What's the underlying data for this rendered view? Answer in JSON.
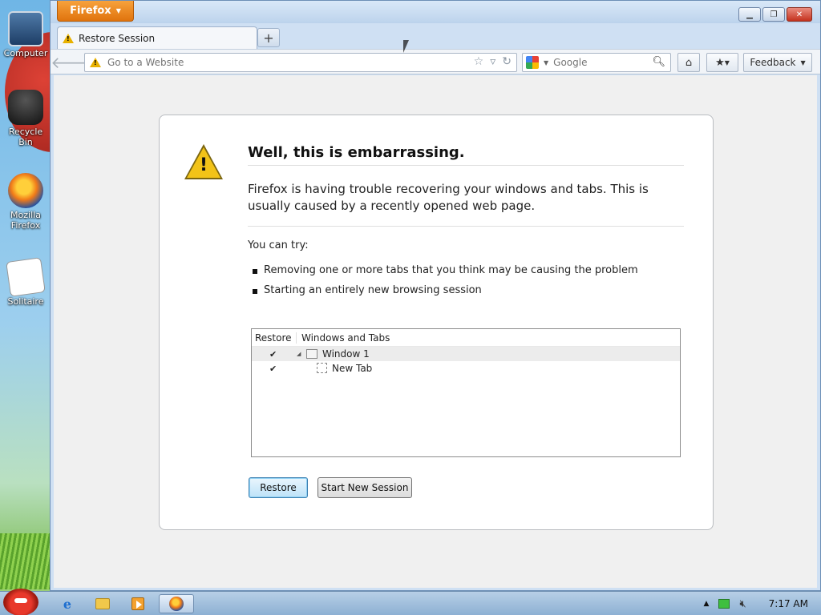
{
  "desktop": {
    "icons": [
      {
        "label": "Computer"
      },
      {
        "label": "Recycle Bin"
      },
      {
        "label": "Mozilla Firefox"
      },
      {
        "label": "Solitaire"
      }
    ]
  },
  "window": {
    "app_button": "Firefox",
    "tab_title": "Restore Session",
    "new_tab_symbol": "+",
    "url_placeholder": "Go to a Website",
    "search_placeholder": "Google",
    "feedback_label": "Feedback"
  },
  "page": {
    "heading": "Well, this is embarrassing.",
    "description": "Firefox is having trouble recovering your windows and tabs. This is usually caused by a recently opened web page.",
    "you_can_try": "You can try:",
    "bullets": [
      "Removing one or more tabs that you think may be causing the problem",
      "Starting an entirely new browsing session"
    ],
    "tree": {
      "col_restore": "Restore",
      "col_windows": "Windows and Tabs",
      "rows": [
        {
          "label": "Window 1",
          "checked": "✔"
        },
        {
          "label": "New Tab",
          "checked": "✔"
        }
      ]
    },
    "buttons": {
      "restore": "Restore",
      "new_session": "Start New Session"
    }
  },
  "taskbar": {
    "clock": "7:17 AM"
  },
  "colors": {
    "firefox_orange": "#e0730d",
    "warning_yellow": "#f2c318",
    "restore_focus": "#3c7fb1"
  }
}
